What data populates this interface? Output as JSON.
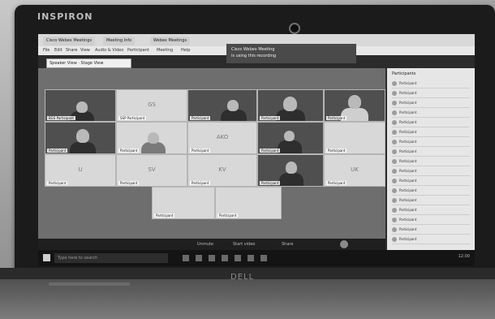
{
  "device": {
    "brand_top": "INSPIRON",
    "brand_bottom": "DELL"
  },
  "browser": {
    "tabs": [
      "Cisco Webex Meetings",
      "Meeting Info",
      "Webex Meetings"
    ],
    "menu": [
      "File",
      "Edit",
      "Share",
      "View",
      "Audio & Video",
      "Participant",
      "Meeting",
      "Help"
    ]
  },
  "notification": {
    "line1": "Cisco Webex Meeting",
    "line2": "is using this recording"
  },
  "session": {
    "label": "Speaker View · Stage View"
  },
  "tiles": {
    "t1": {
      "name": "BGS Participant",
      "initials": ""
    },
    "t2": {
      "name": "SSP Participant",
      "initials": "GS"
    },
    "t3": {
      "name": "Participant",
      "initials": ""
    },
    "t4": {
      "name": "Participant",
      "initials": ""
    },
    "t5": {
      "name": "Participant",
      "initials": ""
    },
    "t6": {
      "name": "Participant",
      "initials": ""
    },
    "t7": {
      "name": "Participant",
      "initials": "YR"
    },
    "t8": {
      "name": "Participant",
      "initials": "AKO"
    },
    "t9": {
      "name": "Participant",
      "initials": ""
    },
    "t10": {
      "name": "Participant",
      "initials": ""
    },
    "t11": {
      "name": "Participant",
      "initials": "U"
    },
    "t12": {
      "name": "Participant",
      "initials": "SV"
    },
    "t13": {
      "name": "Participant",
      "initials": "KV"
    },
    "t14": {
      "name": "Participant",
      "initials": ""
    },
    "t15": {
      "name": "Participant",
      "initials": "UK"
    },
    "t16": {
      "name": "Participant",
      "initials": ""
    },
    "t17": {
      "name": "Participant",
      "initials": ""
    }
  },
  "controls": {
    "mute": "Unmute",
    "video": "Start video",
    "share": "Share"
  },
  "sidebar": {
    "title": "Participants",
    "items": [
      "Participant",
      "Participant",
      "Participant",
      "Participant",
      "Participant",
      "Participant",
      "Participant",
      "Participant",
      "Participant",
      "Participant",
      "Participant",
      "Participant",
      "Participant",
      "Participant",
      "Participant",
      "Participant",
      "Participant"
    ]
  },
  "taskbar": {
    "search": "Type here to search",
    "clock": "12:00"
  }
}
